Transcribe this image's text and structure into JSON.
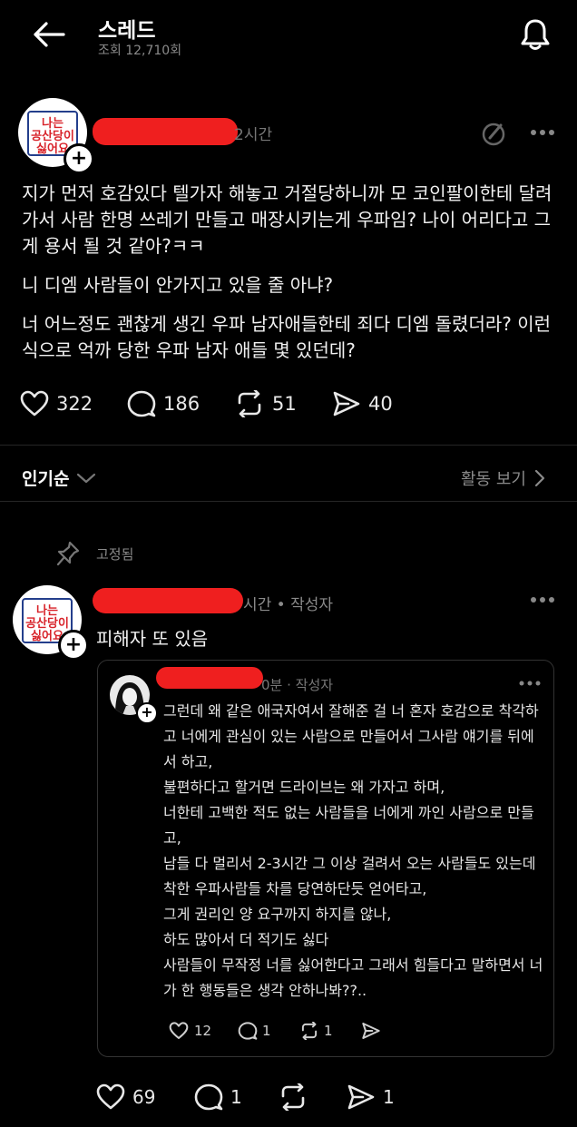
{
  "header": {
    "title": "스레드",
    "views": "조회 12,710회"
  },
  "post": {
    "avatar_text_line1": "나는",
    "avatar_text_line2": "공산당이",
    "avatar_text_line3": "싫어요",
    "time": "2시간",
    "paragraphs": [
      "지가 먼저 호감있다 텔가자 해놓고 거절당하니까 모 코인팔이한테 달려가서 사람 한명 쓰레기 만들고 매장시키는게 우파임? 나이 어리다고 그게 용서 될 것 같아?ㅋㅋ",
      "니 디엠 사람들이 안가지고 있을 줄 아냐?",
      "너 어느정도 괜찮게 생긴 우파 남자애들한테 죄다 디엠 돌렸더라? 이런 식으로 억까 당한 우파 남자 애들 몇 있던데?"
    ],
    "likes": "322",
    "replies": "186",
    "reposts": "51",
    "shares": "40"
  },
  "sort": {
    "label": "인기순",
    "activity": "활동 보기"
  },
  "pinned": {
    "label": "고정됨"
  },
  "comment": {
    "meta": "시간 • 작성자",
    "text": "피해자 또 있음",
    "likes": "69",
    "replies": "1",
    "shares": "1"
  },
  "quoted": {
    "meta": "0분 · 작성자",
    "lines": [
      "그런데 왜 같은 애국자여서 잘해준 걸 너 혼자 호감으로 착각하고 너에게 관심이 있는 사람으로 만들어서 그사람 얘기를 뒤에서 하고,",
      "불편하다고 할거면 드라이브는 왜 가자고 하며,",
      "너한테 고백한 적도 없는 사람들을 너에게 까인 사람으로 만들고,",
      "남들 다 멀리서 2-3시간 그 이상 걸려서 오는 사람들도 있는데 착한 우파사람들 차를 당연하단듯 얻어타고,",
      "그게 권리인 양 요구까지 하지를 않나,",
      "하도 많아서 더 적기도 싫다",
      "사람들이 무작정 너를 싫어한다고 그래서 힘들다고 말하면서 너가 한 행동들은 생각 안하나봐??.."
    ],
    "likes": "12",
    "replies": "1",
    "reposts": "1"
  },
  "colors": {
    "background": "#000000",
    "redaction": "#ef1f1f",
    "muted": "#8a8a8a"
  }
}
